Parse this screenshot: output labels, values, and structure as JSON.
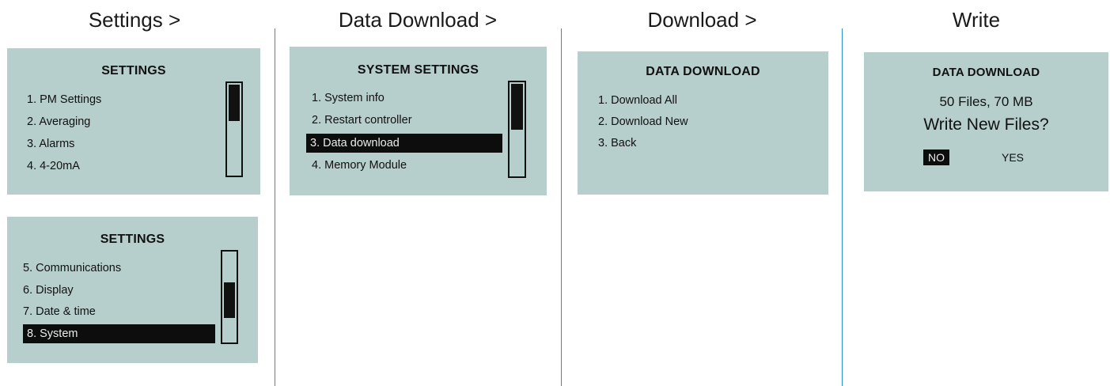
{
  "columns": [
    {
      "title": "Settings >"
    },
    {
      "title": "Data Download >"
    },
    {
      "title": "Download >"
    },
    {
      "title": "Write"
    }
  ],
  "screens": {
    "settings_1": {
      "title": "SETTINGS",
      "items": [
        "1. PM Settings",
        "2. Averaging",
        "3. Alarms",
        "4. 4-20mA"
      ],
      "scroll_position": 0
    },
    "settings_2": {
      "title": "SETTINGS",
      "items": [
        "5. Communications",
        "6. Display",
        "7. Date & time",
        "8. System"
      ],
      "selected_item": "8. System",
      "scroll_position": 0.55
    },
    "system_settings": {
      "title": "SYSTEM SETTINGS",
      "items": [
        "1.  System info",
        "2. Restart controller",
        "3. Data download",
        "4. Memory Module"
      ],
      "selected_item": "3. Data download",
      "scroll_position": 0
    },
    "data_download": {
      "title": "DATA DOWNLOAD",
      "items": [
        "1.  Download All",
        "2. Download New",
        "3. Back"
      ]
    },
    "write_confirm": {
      "title": "DATA DOWNLOAD",
      "summary": "50 Files, 70 MB",
      "question": "Write New Files?",
      "no_label": "NO",
      "yes_label": "YES",
      "selected_choice": "NO"
    }
  },
  "colors": {
    "screen_background": "#b6cfcc",
    "selection": "#0d0d0d",
    "divider": "#2e8fd0"
  }
}
